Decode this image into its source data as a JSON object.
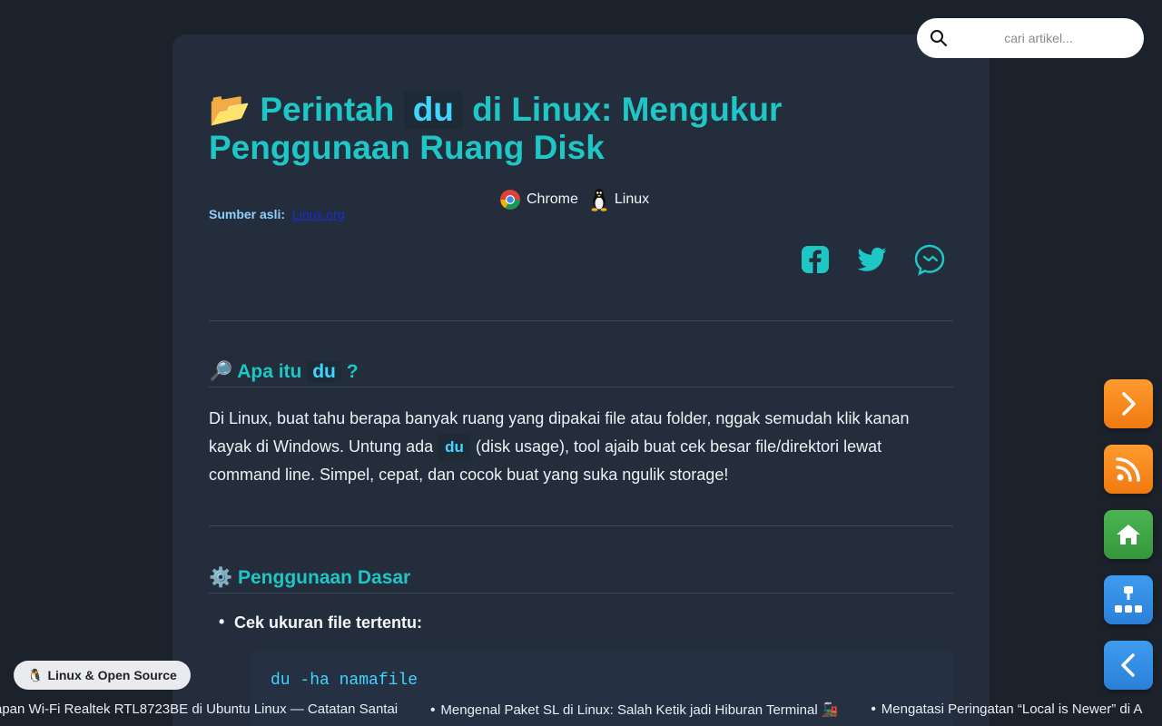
{
  "article": {
    "title_emoji": "📂",
    "title_pre": "Perintah",
    "title_code": "du",
    "title_post": "di Linux: Mengukur Penggunaan Ruang Disk",
    "badges": [
      {
        "icon": "chrome-icon",
        "label": "Chrome"
      },
      {
        "icon": "linux-penguin-icon",
        "label": "Linux"
      }
    ],
    "source_label": "Sumber asli:",
    "source_link": "Linux.org",
    "share_icons": [
      "facebook-icon",
      "twitter-icon",
      "threads-icon"
    ]
  },
  "sections": {
    "s1": {
      "emoji": "🔎",
      "title_pre": "Apa itu",
      "title_code": "du",
      "title_post": "?",
      "para_1": "Di Linux, buat tahu berapa banyak ruang yang dipakai file atau folder, nggak semudah klik kanan kayak di Windows. Untung ada",
      "para_code": "du",
      "para_2": "(disk usage), tool ajaib buat cek besar file/direktori lewat command line. Simpel, cepat, dan cocok buat yang suka ngulik storage!"
    },
    "s2": {
      "emoji": "⚙️",
      "title": "Penggunaan Dasar",
      "bullet": "Cek ukuran file tertentu:",
      "code": "du -ha namafile"
    }
  },
  "search": {
    "placeholder": "cari artikel..."
  },
  "fab_buttons": [
    {
      "name": "next-button",
      "icon": "chevron-right-icon",
      "color": "#f7851c"
    },
    {
      "name": "rss-button",
      "icon": "rss-icon",
      "color": "#f7851c"
    },
    {
      "name": "home-button",
      "icon": "home-icon",
      "color": "#3fa645"
    },
    {
      "name": "sitemap-button",
      "icon": "sitemap-icon",
      "color": "#2f8fe6"
    },
    {
      "name": "prev-button",
      "icon": "chevron-left-icon",
      "color": "#2f8fe6"
    }
  ],
  "tag": {
    "emoji": "🐧",
    "label": "Linux & Open Source"
  },
  "ticker": [
    "apan Wi-Fi Realtek RTL8723BE di Ubuntu Linux — Catatan Santai",
    "Mengenal Paket SL di Linux: Salah Ketik jadi Hiburan Terminal 🚂",
    "Mengatasi Peringatan “Local is Newer” di A"
  ],
  "colors": {
    "accent": "#1ec6c6",
    "code": "#3fd5ff",
    "card": "#232d3c",
    "bg": "#1c222b"
  }
}
